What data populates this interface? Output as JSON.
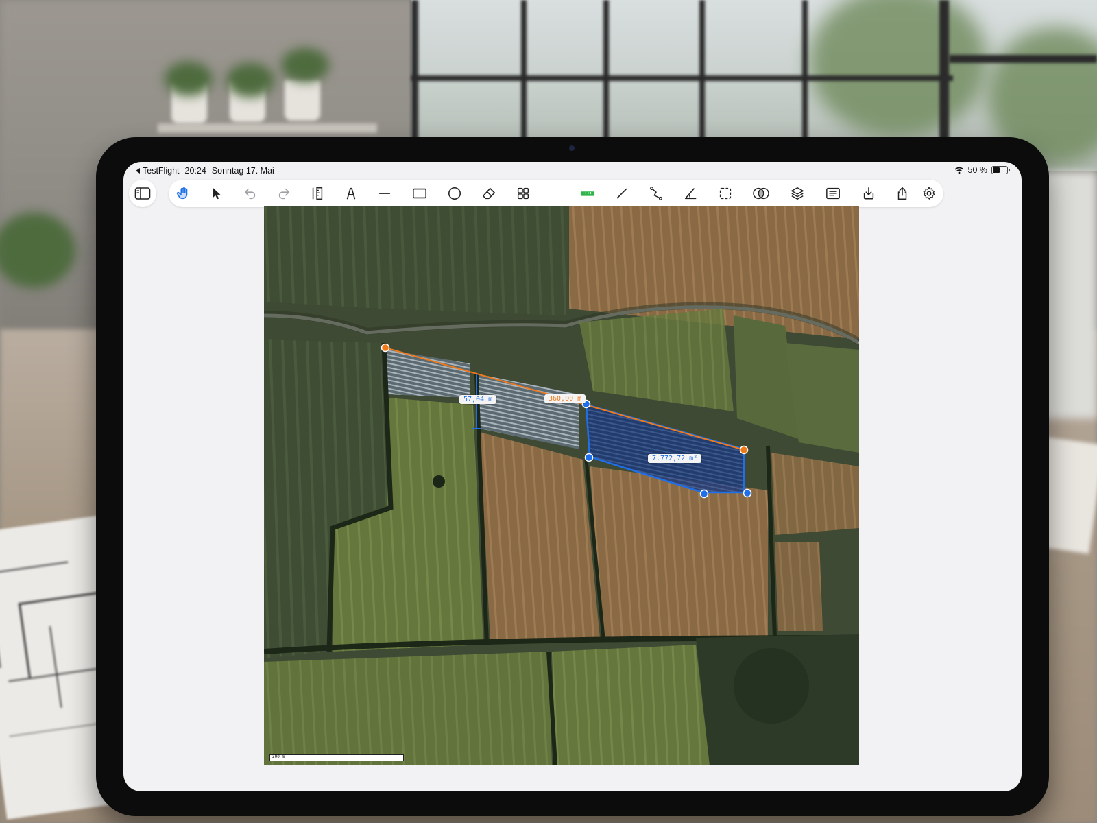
{
  "status_bar": {
    "back_app": "TestFlight",
    "time": "20:24",
    "date": "Sonntag 17. Mai",
    "battery": "50 %",
    "battery_level": 0.5
  },
  "toolbar": {
    "tools": [
      {
        "name": "pan-hand",
        "icon": "hand-tap-icon",
        "active": true
      },
      {
        "name": "select",
        "icon": "cursor-arrow-icon"
      },
      {
        "name": "undo",
        "icon": "undo-icon"
      },
      {
        "name": "redo",
        "icon": "redo-icon"
      },
      {
        "name": "ruler",
        "icon": "ruler-icon"
      },
      {
        "name": "pen",
        "icon": "pen-nib-icon"
      },
      {
        "name": "line",
        "icon": "minus-line-icon"
      },
      {
        "name": "rectangle",
        "icon": "rectangle-icon"
      },
      {
        "name": "circle",
        "icon": "circle-icon"
      },
      {
        "name": "eraser",
        "icon": "eraser-icon"
      },
      {
        "name": "grid",
        "icon": "grid-icon"
      },
      {
        "name": "scale",
        "icon": "scale-ruler-green-icon"
      },
      {
        "name": "measure-line",
        "icon": "diagonal-line-icon"
      },
      {
        "name": "polyline",
        "icon": "polyline-icon"
      },
      {
        "name": "angle",
        "icon": "angle-icon"
      },
      {
        "name": "area",
        "icon": "dashed-rectangle-icon"
      },
      {
        "name": "overlap",
        "icon": "overlap-circles-icon"
      },
      {
        "name": "layers",
        "icon": "layers-icon"
      },
      {
        "name": "list",
        "icon": "list-icon"
      },
      {
        "name": "import",
        "icon": "import-tray-icon"
      },
      {
        "name": "share",
        "icon": "share-icon"
      },
      {
        "name": "settings",
        "icon": "gear-icon"
      }
    ]
  },
  "map": {
    "measurements": {
      "width_label": "57,04 m",
      "length_label": "360,00 m",
      "area_label": "7.772,72 m²"
    },
    "scale_label": "200 m"
  },
  "colors": {
    "accent_blue": "#1f6fe8",
    "measure_orange": "#f07a1a",
    "toolbar_bg": "#ffffff",
    "screen_bg": "#f2f2f4"
  }
}
